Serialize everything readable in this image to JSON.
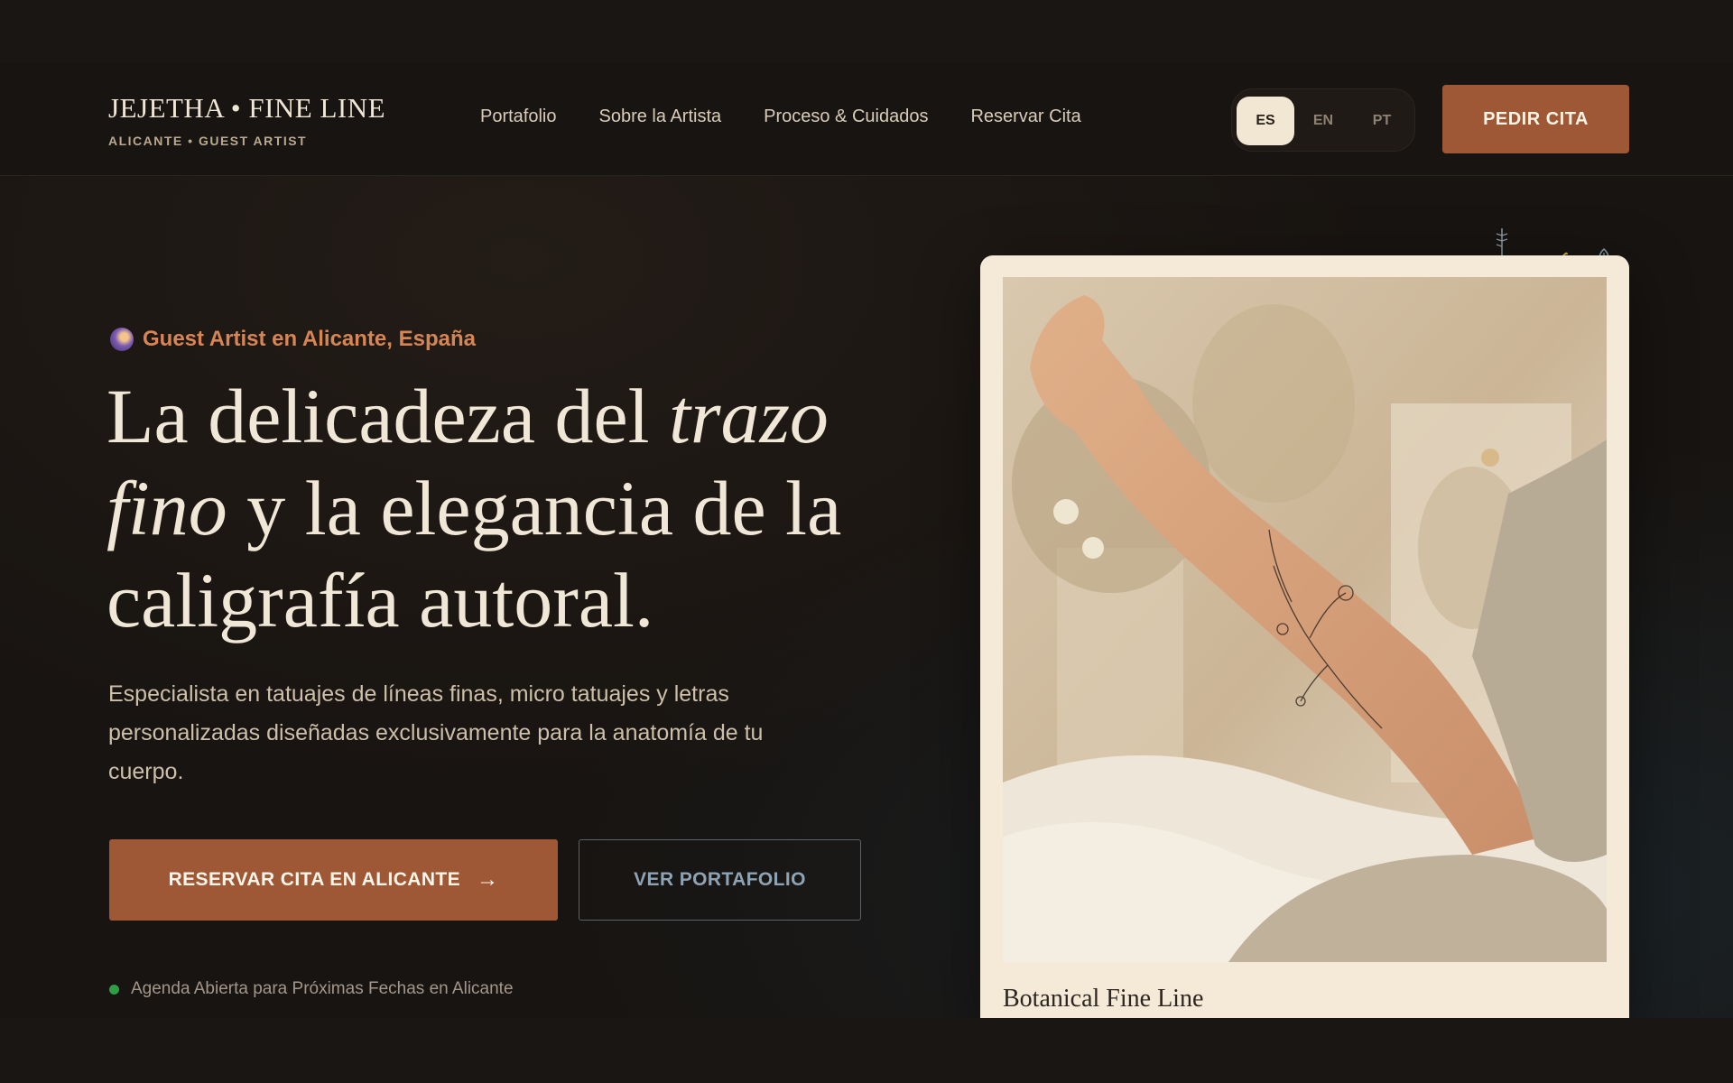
{
  "header": {
    "logo_title": "JEJETHA • FINE LINE",
    "logo_subtitle": "ALICANTE • GUEST ARTIST",
    "nav": [
      {
        "label": "Portafolio"
      },
      {
        "label": "Sobre la Artista"
      },
      {
        "label": "Proceso & Cuidados"
      },
      {
        "label": "Reservar Cita"
      }
    ],
    "languages": [
      {
        "code": "ES",
        "active": true
      },
      {
        "code": "EN",
        "active": false
      },
      {
        "code": "PT",
        "active": false
      }
    ],
    "cta_label": "PEDIR CITA"
  },
  "hero": {
    "eyebrow": "Guest Artist en Alicante, España",
    "headline": {
      "part1": "La delicadeza del ",
      "italic1": "trazo fino",
      "part2": " y la elegancia de la caligrafía autoral."
    },
    "description": "Especialista en tatuajes de líneas finas, micro tatuajes y letras personalizadas diseñadas exclusivamente para la anatomía de tu cuerpo.",
    "primary_button": "RESERVAR CITA EN ALICANTE",
    "secondary_button": "VER PORTAFOLIO",
    "status": "Agenda Abierta para Próximas Fechas en Alicante"
  },
  "card": {
    "caption": "Botanical Fine Line"
  },
  "icons": {
    "eyebrow": "moon-icon",
    "arrow": "arrow-right-icon",
    "status": "status-dot-icon",
    "decorations": [
      "sprig-icon",
      "squiggle-icon",
      "leaf-icon"
    ]
  },
  "colors": {
    "background": "#181411",
    "accent": "#9f5835",
    "eyebrow_accent": "#d88555",
    "cream": "#f4ead7",
    "status_green": "#2e9e45"
  }
}
